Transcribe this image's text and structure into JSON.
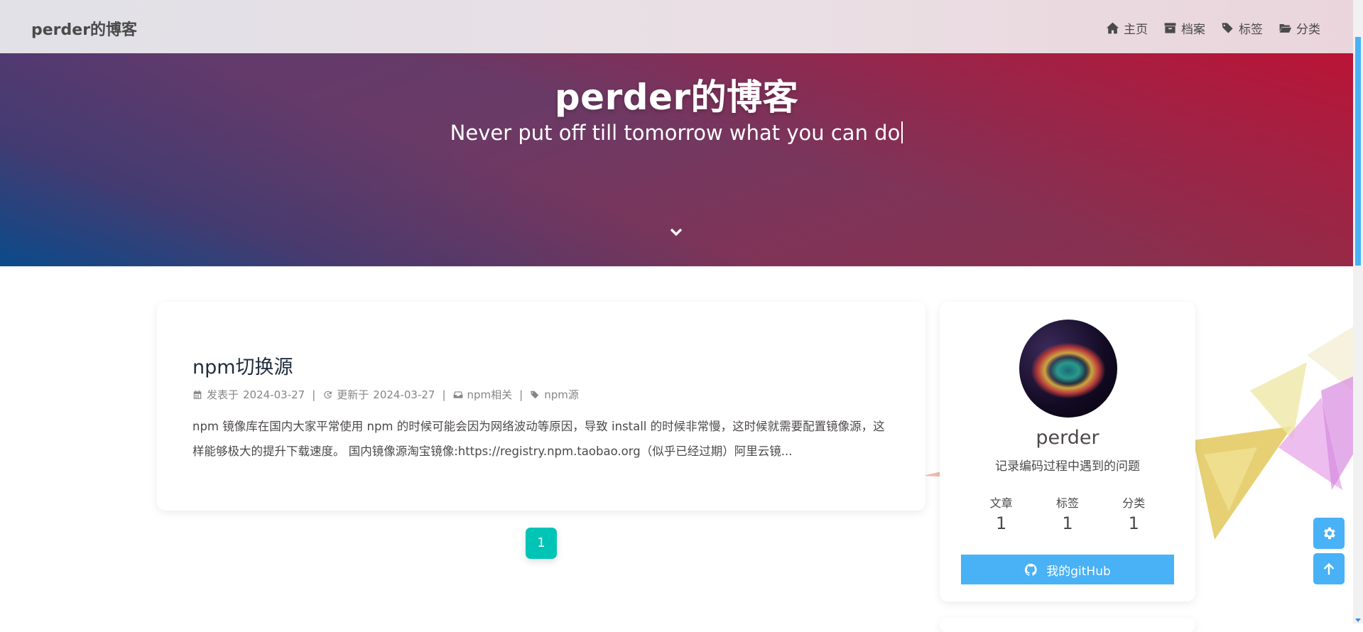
{
  "nav": {
    "brand": "perder的博客",
    "menu": [
      {
        "label": "主页",
        "icon": "home-icon"
      },
      {
        "label": "档案",
        "icon": "archive-icon"
      },
      {
        "label": "标签",
        "icon": "tags-icon"
      },
      {
        "label": "分类",
        "icon": "folder-open-icon"
      }
    ]
  },
  "hero": {
    "title": "perder的博客",
    "subtitle": "Never put off till tomorrow what you can do",
    "scroll_icon": "chevron-down-icon"
  },
  "post": {
    "title": "npm切换源",
    "published_label": "发表于",
    "published_date": "2024-03-27",
    "updated_label": "更新于",
    "updated_date": "2024-03-27",
    "category": "npm相关",
    "tag": "npm源",
    "separator": "|",
    "excerpt": "npm 镜像库在国内大家平常使用 npm 的时候可能会因为网络波动等原因，导致 install 的时候非常慢，这时候就需要配置镜像源，这样能够极大的提升下载速度。 国内镜像源淘宝镜像:https://registry.npm.taobao.org（似乎已经过期）阿里云镜..."
  },
  "pagination": {
    "current": "1"
  },
  "profile": {
    "name": "perder",
    "description": "记录编码过程中遇到的问题",
    "stats": [
      {
        "label": "文章",
        "value": "1"
      },
      {
        "label": "标签",
        "value": "1"
      },
      {
        "label": "分类",
        "value": "1"
      }
    ],
    "github_label": "我的gitHub"
  },
  "colors": {
    "accent": "#49b1f5",
    "pagination": "#00c4b6",
    "text": "#4c4948"
  },
  "floating_buttons": [
    "settings-icon",
    "arrow-up-icon"
  ]
}
